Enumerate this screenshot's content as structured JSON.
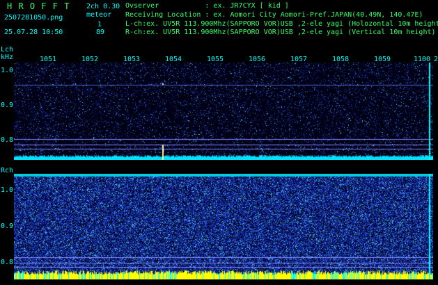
{
  "header": {
    "title": "H R O F F T",
    "ch_info": "2ch 0.30",
    "filename": "2507281050.png",
    "meteor_label": "meteor",
    "datetime": "25.07.28 10:50",
    "meteor_col1": "1",
    "meteor_col2": "89",
    "observer": "Ovserver           : ex. JR7CYX [ kid ]",
    "location": "Receiving Location : ex. Aomori City Aomori-Pref.JAPAN(40.49N, 140.47E)",
    "lch": "L-ch:ex. UV5R 113.900Mhz(SAPPORO VOR)USB ,2-ele yagi (Holozontal 10m height)",
    "rch": "R-ch:ex. UV5R 113.900Mhz(SAPPORO VOR)USB ,2-ele yagi (Vertical 10m height)"
  },
  "axis": {
    "lch_label": "Lch",
    "unit_label": "kHz",
    "rch_label": "Rch",
    "time_ticks": [
      "1051",
      "1052",
      "1053",
      "1054",
      "1055",
      "1056",
      "1057",
      "1058",
      "1059",
      "1100"
    ],
    "edge_tick": "2",
    "top_freq_ticks": [
      "1.0",
      "0.9",
      "0.8"
    ],
    "bottom_freq_ticks": [
      "1.0",
      "0.9",
      "0.8"
    ]
  },
  "colors": {
    "background": "#000000",
    "axis_text": "#00ffff",
    "header_text": "#33ff66",
    "count_text": "#ffff44",
    "signal_line": "#00ffff",
    "noise_line": "#ffff00"
  }
}
